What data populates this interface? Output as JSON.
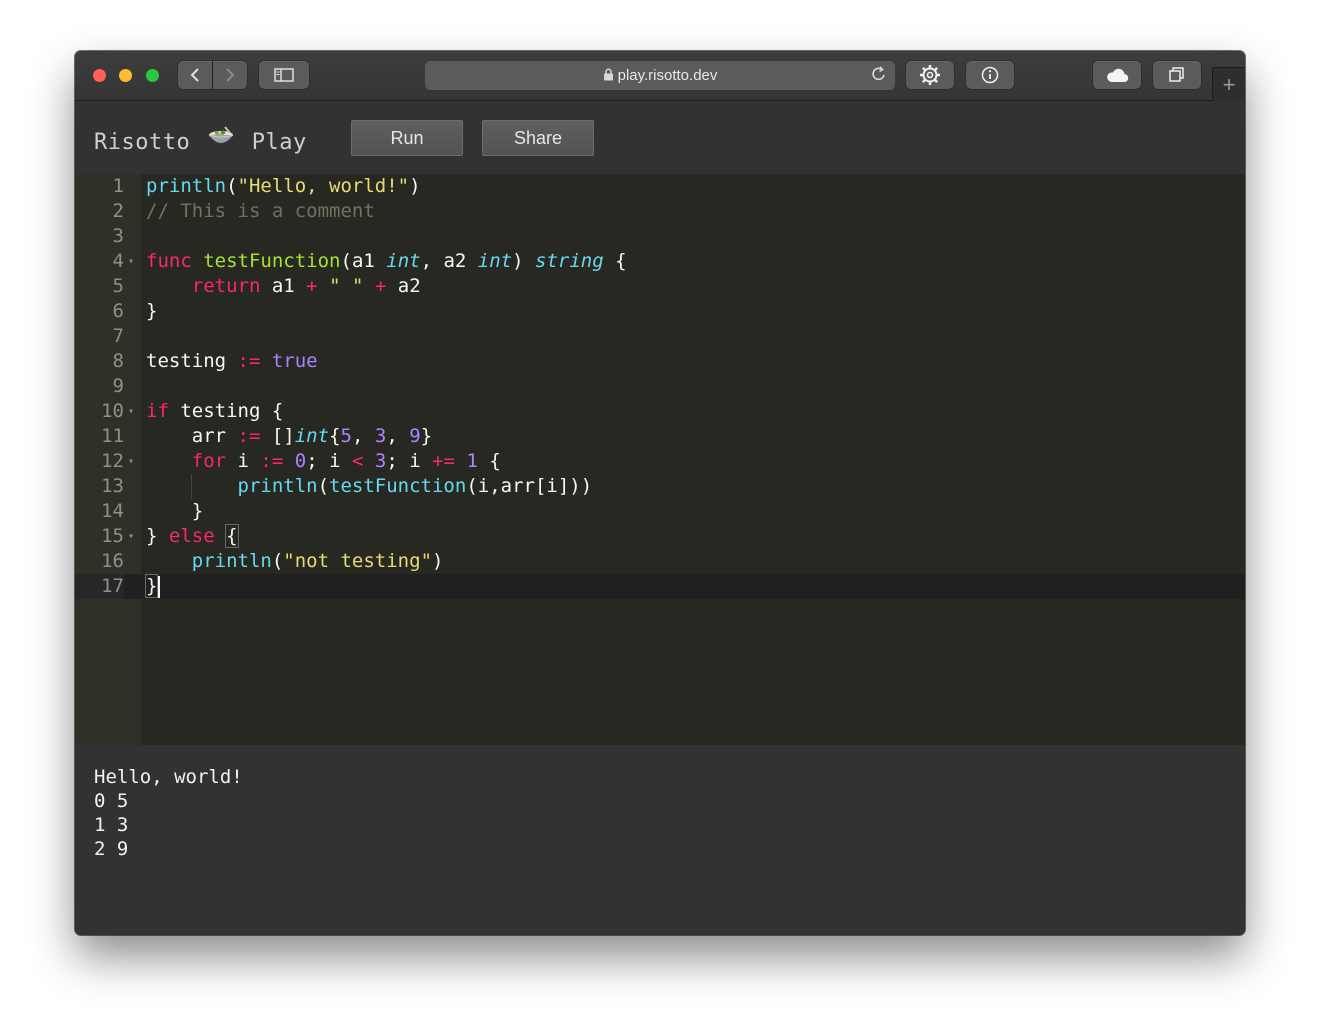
{
  "browser": {
    "url": "play.risotto.dev",
    "icons": [
      "back-icon",
      "forward-icon",
      "sidebar-icon",
      "lock-icon",
      "reload-icon",
      "settings-icon",
      "info-icon",
      "cloud-icon",
      "tabs-icon",
      "plus-icon"
    ]
  },
  "app": {
    "brand_left": "Risotto",
    "brand_right": "Play",
    "run_label": "Run",
    "share_label": "Share"
  },
  "editor": {
    "line_numbers": [
      "1",
      "2",
      "3",
      "4",
      "5",
      "6",
      "7",
      "8",
      "9",
      "10",
      "11",
      "12",
      "13",
      "14",
      "15",
      "16",
      "17"
    ],
    "active_line": "17",
    "lines": [
      "println(\"Hello, world!\")",
      "// This is a comment",
      "",
      "func testFunction(a1 int, a2 int) string {",
      "    return a1 + \" \" + a2",
      "}",
      "",
      "testing := true",
      "",
      "if testing {",
      "    arr := []int{5, 3, 9}",
      "    for i := 0; i < 3; i += 1 {",
      "        println(testFunction(i,arr[i]))",
      "    }",
      "} else {",
      "    println(\"not testing\")",
      "}"
    ]
  },
  "output": {
    "lines": [
      "Hello, world!",
      "0 5",
      "1 3",
      "2 9"
    ]
  }
}
